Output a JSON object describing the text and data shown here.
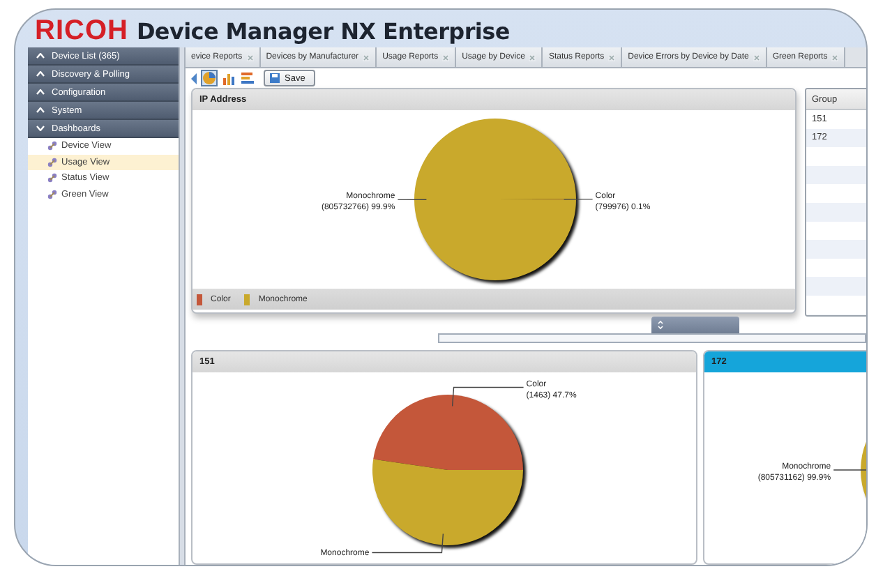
{
  "header": {
    "logo": "RICOH",
    "title": "Device Manager NX Enterprise"
  },
  "sidebar": {
    "sections": [
      {
        "label": "Device List (365)",
        "expanded": false
      },
      {
        "label": "Discovery & Polling",
        "expanded": false
      },
      {
        "label": "Configuration",
        "expanded": false
      },
      {
        "label": "System",
        "expanded": false
      },
      {
        "label": "Dashboards",
        "expanded": true,
        "children": [
          {
            "label": "Device View",
            "selected": false
          },
          {
            "label": "Usage View",
            "selected": true
          },
          {
            "label": "Status View",
            "selected": false
          },
          {
            "label": "Green View",
            "selected": false
          }
        ]
      }
    ]
  },
  "tabs": [
    {
      "label": "evice Reports"
    },
    {
      "label": "Devices by Manufacturer"
    },
    {
      "label": "Usage Reports"
    },
    {
      "label": "Usage by Device"
    },
    {
      "label": "Status Reports"
    },
    {
      "label": "Device Errors by Device by Date"
    },
    {
      "label": "Green Reports"
    }
  ],
  "toolbar": {
    "views": [
      {
        "kind": "pie",
        "selected": true
      },
      {
        "kind": "bar",
        "selected": false
      },
      {
        "kind": "stacked",
        "selected": false
      }
    ],
    "save": "Save"
  },
  "ip_panel": {
    "title": "IP Address",
    "chart_data": {
      "type": "pie",
      "categories": [
        "Color",
        "Monochrome"
      ],
      "values": [
        0.1,
        99.9
      ],
      "colors": [
        "#c4573a",
        "#c9a92c"
      ],
      "value_labels": [
        "(799976) 0.1%",
        "(805732766) 99.9%"
      ]
    },
    "legend": [
      {
        "label": "Color",
        "color": "#c4573a"
      },
      {
        "label": "Monochrome",
        "color": "#c9a92c"
      }
    ]
  },
  "group_table": {
    "columns": [
      "Group"
    ],
    "rows": [
      [
        "151"
      ],
      [
        "172"
      ]
    ]
  },
  "group_panels": [
    {
      "title": "151",
      "highlighted": false,
      "chart_data": {
        "type": "pie",
        "categories": [
          "Color",
          "Monochrome"
        ],
        "values": [
          47.7,
          52.3
        ],
        "colors": [
          "#c4573a",
          "#c9a92c"
        ],
        "value_labels": [
          "(1463) 47.7%",
          null
        ]
      }
    },
    {
      "title": "172",
      "highlighted": true,
      "chart_data": {
        "type": "pie",
        "categories": [
          "Monochrome"
        ],
        "values": [
          99.9
        ],
        "colors": [
          "#c9a92c"
        ],
        "value_labels": [
          "(805731162) 99.9%"
        ]
      }
    }
  ]
}
